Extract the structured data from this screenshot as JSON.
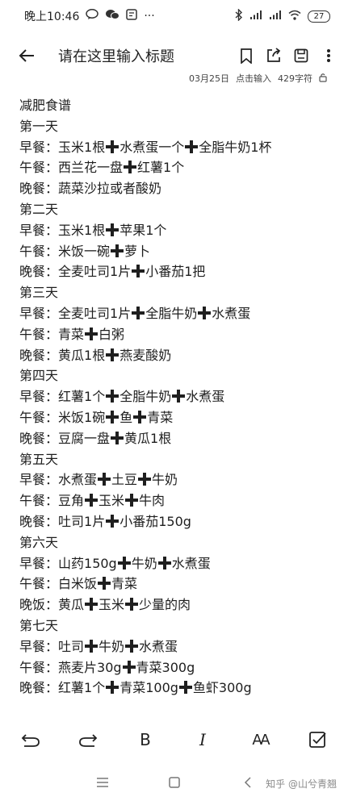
{
  "status_bar": {
    "time": "晚上10:46",
    "battery": "27"
  },
  "app_bar": {
    "title": "请在这里输入标题"
  },
  "meta": {
    "date": "03月25日",
    "action": "点击输入",
    "count": "429字符"
  },
  "note": {
    "title": "减肥食谱",
    "days": [
      {
        "label": "第一天",
        "meals": [
          {
            "prefix": "早餐：",
            "items": [
              "玉米1根",
              "水煮蛋一个",
              "全脂牛奶1杯"
            ]
          },
          {
            "prefix": "午餐：",
            "items": [
              "西兰花一盘",
              "红薯1个"
            ]
          },
          {
            "prefix": "晚餐：",
            "items": [
              "蔬菜沙拉或者酸奶"
            ]
          }
        ]
      },
      {
        "label": "第二天",
        "meals": [
          {
            "prefix": "早餐：",
            "items": [
              "玉米1根",
              "苹果1个"
            ]
          },
          {
            "prefix": "午餐：",
            "items": [
              "米饭一碗",
              "萝卜"
            ]
          },
          {
            "prefix": "晚餐：",
            "items": [
              "全麦吐司1片",
              "小番茄1把"
            ]
          }
        ]
      },
      {
        "label": "第三天",
        "meals": [
          {
            "prefix": "早餐：",
            "items": [
              "全麦吐司1片",
              "全脂牛奶",
              "水煮蛋"
            ]
          },
          {
            "prefix": "午餐：",
            "items": [
              "青菜",
              "白粥"
            ]
          },
          {
            "prefix": "晚餐：",
            "items": [
              "黄瓜1根",
              "燕麦酸奶"
            ]
          }
        ]
      },
      {
        "label": "第四天",
        "meals": [
          {
            "prefix": "早餐：",
            "items": [
              "红薯1个",
              "全脂牛奶",
              "水煮蛋"
            ]
          },
          {
            "prefix": "午餐：",
            "items": [
              "米饭1碗",
              "鱼",
              "青菜"
            ]
          },
          {
            "prefix": "晚餐：",
            "items": [
              "豆腐一盘",
              "黄瓜1根"
            ]
          }
        ]
      },
      {
        "label": "第五天",
        "meals": [
          {
            "prefix": "早餐：",
            "items": [
              "水煮蛋",
              "土豆",
              "牛奶"
            ]
          },
          {
            "prefix": "午餐：",
            "items": [
              "豆角",
              "玉米",
              "牛肉"
            ]
          },
          {
            "prefix": "晚餐：",
            "items": [
              "吐司1片",
              "小番茄150g"
            ]
          }
        ]
      },
      {
        "label": "第六天",
        "meals": [
          {
            "prefix": "早餐：",
            "items": [
              "山药150g",
              "牛奶",
              "水煮蛋"
            ]
          },
          {
            "prefix": "午餐：",
            "items": [
              "白米饭",
              "青菜"
            ]
          },
          {
            "prefix": "晚饭：",
            "items": [
              "黄瓜",
              "玉米",
              "少量的肉"
            ]
          }
        ]
      },
      {
        "label": "第七天",
        "meals": [
          {
            "prefix": "早餐：",
            "items": [
              "吐司",
              "牛奶",
              "水煮蛋"
            ]
          },
          {
            "prefix": "午餐：",
            "items": [
              "燕麦片30g",
              "青菜300g"
            ]
          },
          {
            "prefix": "晚餐：",
            "items": [
              "红薯1个",
              "青菜100g",
              "鱼虾300g"
            ]
          }
        ]
      }
    ]
  },
  "toolbar": {
    "bold_label": "B",
    "italic_label": "I",
    "font_label": "AA"
  },
  "watermark": "知乎 @山兮青翘",
  "icons": {
    "plus_color": "#1f1f1f"
  }
}
